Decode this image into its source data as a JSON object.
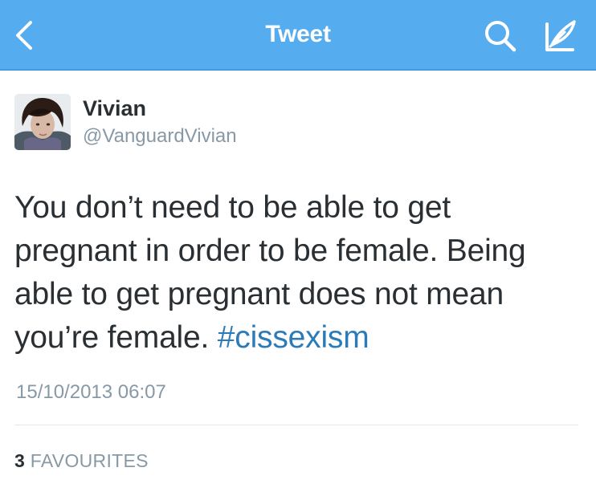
{
  "navbar": {
    "title": "Tweet",
    "back_icon": "chevron-left-icon",
    "search_icon": "search-icon",
    "compose_icon": "compose-tweet-icon",
    "background_color": "#55acee"
  },
  "tweet": {
    "author": {
      "display_name": "Vivian",
      "handle": "@VanguardVivian"
    },
    "text_before_hashtag": "You don’t need to be able to get pregnant in order to be female. Being able to get pregnant does not mean you’re female. ",
    "hashtag": "#cissexism",
    "timestamp": "15/10/2013 06:07",
    "favourites": {
      "count": "3",
      "label": "FAVOURITES"
    }
  },
  "colors": {
    "text_primary": "#292f33",
    "text_secondary": "#8899a6",
    "link": "#2b7bb9",
    "divider": "#e1e8ed"
  }
}
